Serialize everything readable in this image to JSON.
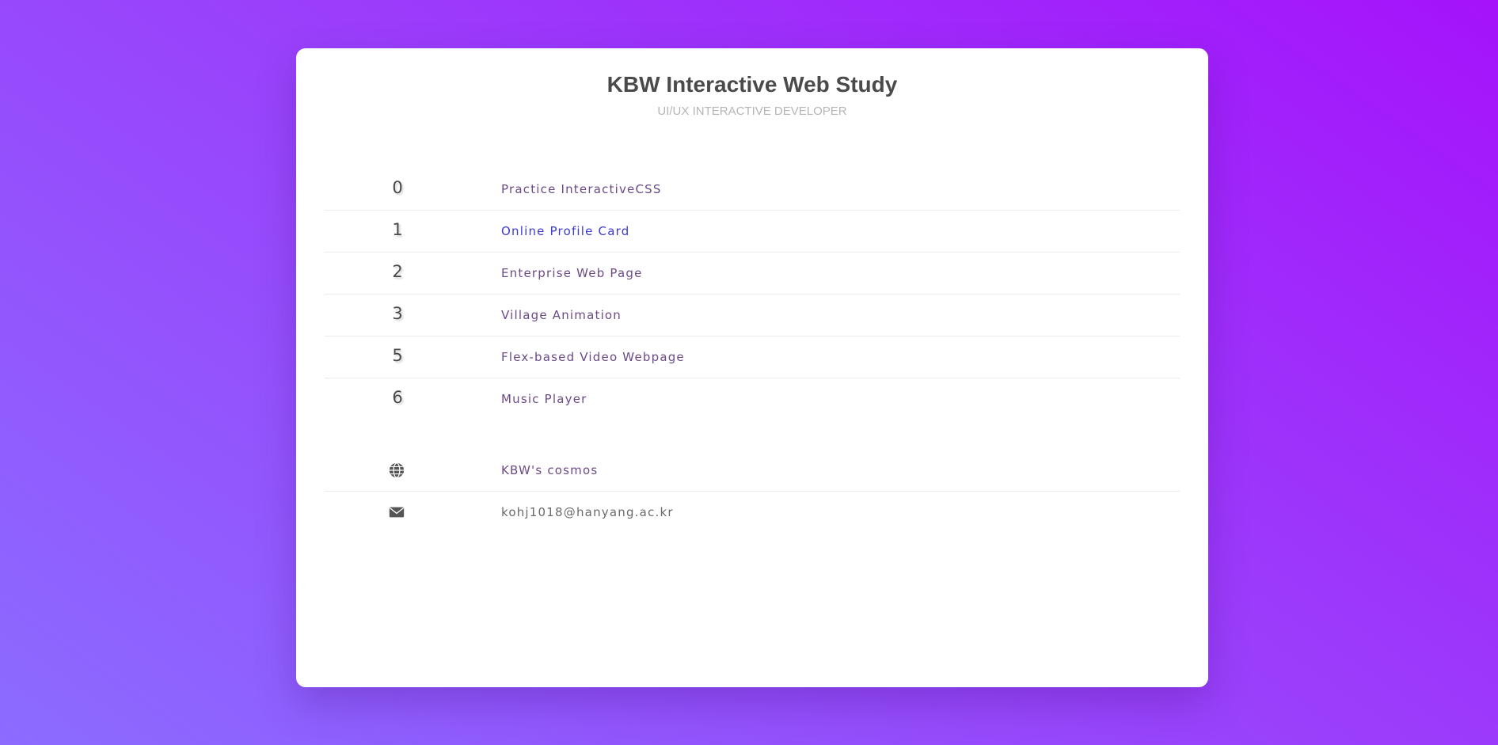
{
  "header": {
    "title": "KBW Interactive Web Study",
    "subtitle": "UI/UX INTERACTIVE DEVELOPER"
  },
  "projects": [
    {
      "number": "0",
      "label": "Practice InteractiveCSS"
    },
    {
      "number": "1",
      "label": "Online Profile Card"
    },
    {
      "number": "2",
      "label": "Enterprise Web Page"
    },
    {
      "number": "3",
      "label": "Village Animation"
    },
    {
      "number": "5",
      "label": "Flex-based Video Webpage"
    },
    {
      "number": "6",
      "label": "Music Player"
    }
  ],
  "links": [
    {
      "icon": "globe-icon",
      "label": "KBW's cosmos"
    },
    {
      "icon": "envelope-icon",
      "label": "kohj1018@hanyang.ac.kr"
    }
  ],
  "colors": {
    "background_start": "#8b6cff",
    "background_end": "#a512fb",
    "link_default": "#6b4a86",
    "link_visited": "#3b3bd1",
    "text_dark": "#4a4a4a"
  }
}
